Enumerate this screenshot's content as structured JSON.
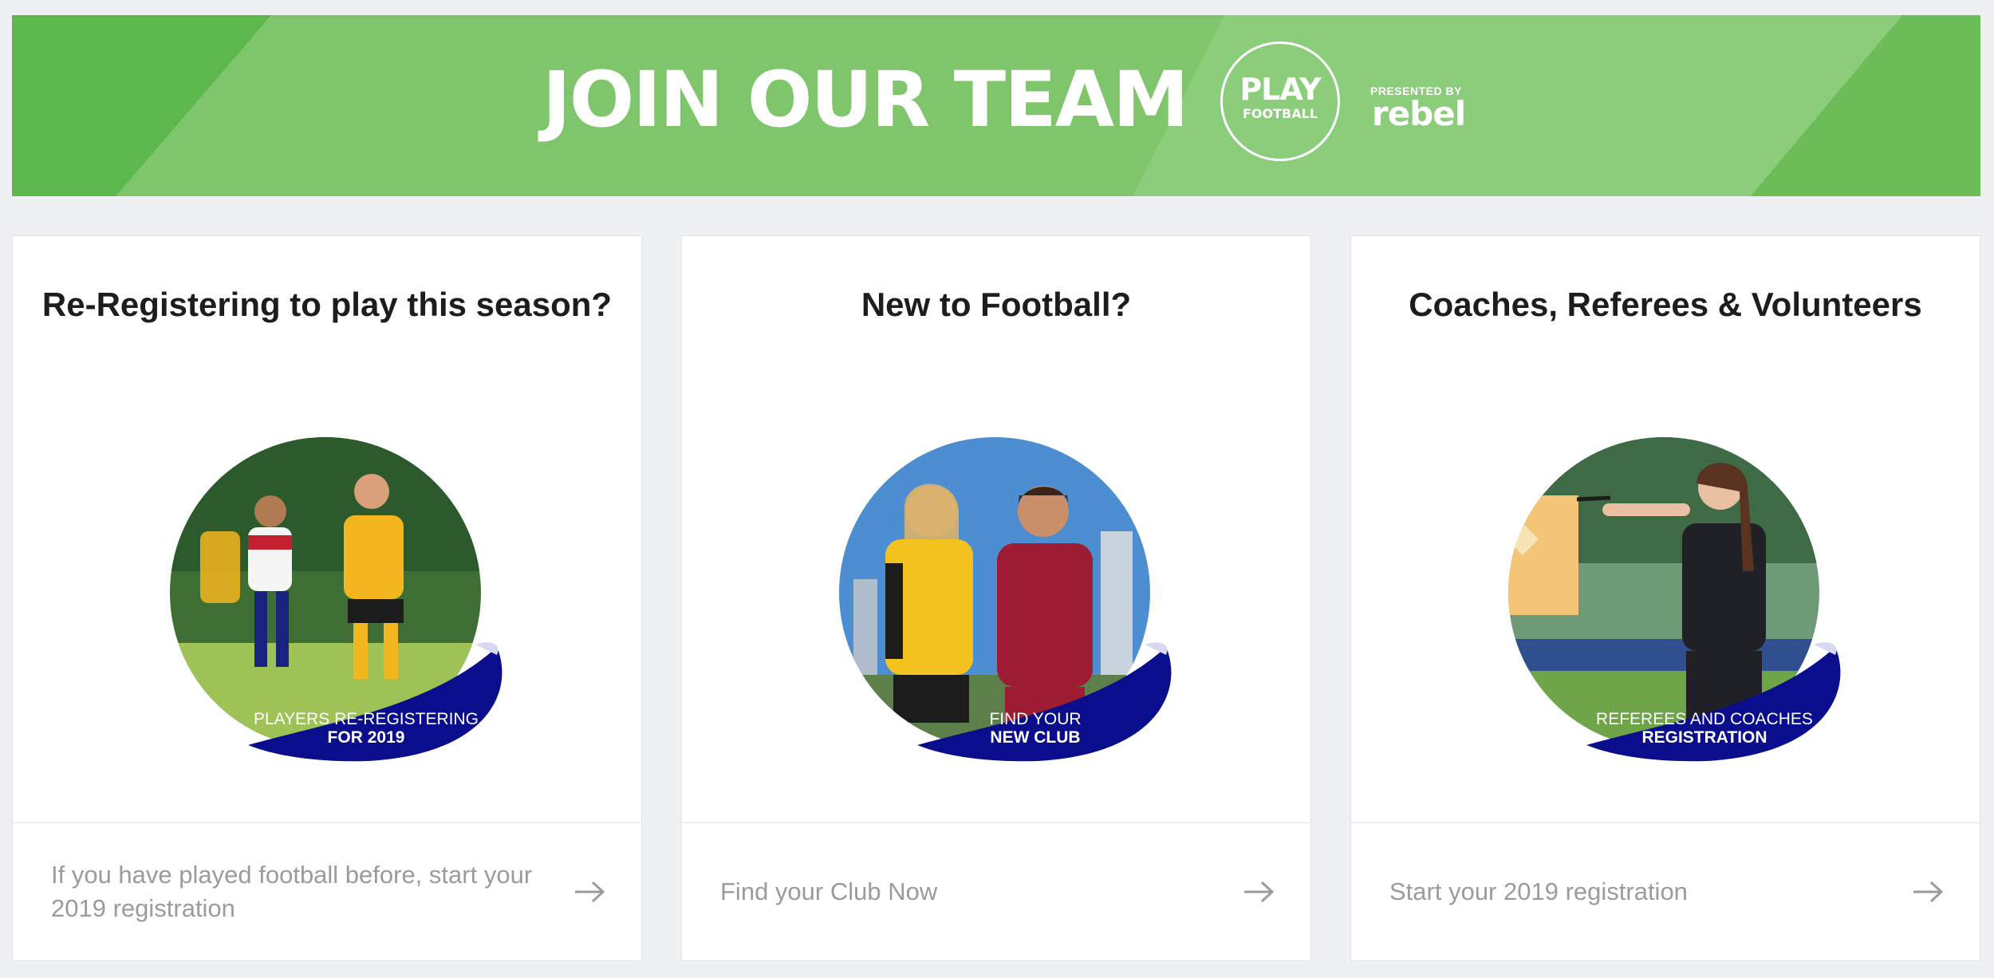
{
  "banner": {
    "title": "JOIN OUR TEAM",
    "logo_play": "PLAY",
    "logo_football": "FOOTBALL",
    "presented_by": "PRESENTED BY",
    "sponsor": "rebel",
    "colors": {
      "base": "#7fc56c",
      "dark": "#5cb84c",
      "light": "#8ccd7b"
    }
  },
  "cards": [
    {
      "title": "Re-Registering to play this season?",
      "badge_line1": "PLAYERS RE-REGISTERING",
      "badge_line2": "FOR 2019",
      "footer_text": "If you have played football before, start your 2019 registration",
      "arrow_icon": "arrow-right-icon"
    },
    {
      "title": "New to Football?",
      "badge_line1": "FIND YOUR",
      "badge_line2": "NEW CLUB",
      "footer_text": "Find your Club Now",
      "arrow_icon": "arrow-right-icon"
    },
    {
      "title": "Coaches, Referees & Volunteers",
      "badge_line1": "REFEREES AND COACHES",
      "badge_line2": "REGISTRATION",
      "footer_text": "Start your 2019 registration",
      "arrow_icon": "arrow-right-icon"
    }
  ],
  "colors": {
    "ribbon": "#0a0e8c",
    "title_text": "#1d1d1f",
    "footer_text": "#9a9b9f",
    "page_bg": "#eff0f2"
  }
}
